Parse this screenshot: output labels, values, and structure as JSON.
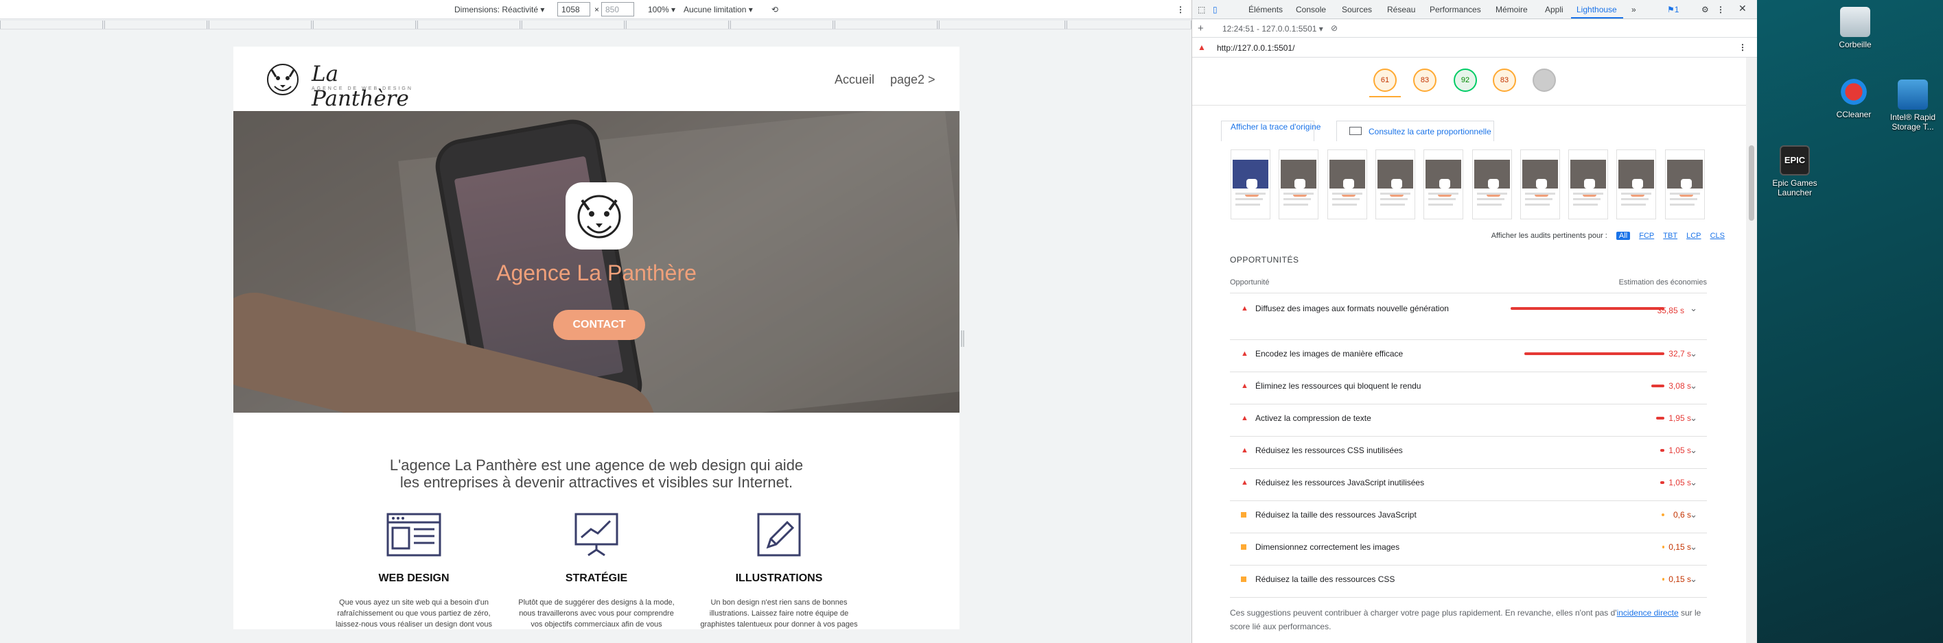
{
  "devtools_toolbar": {
    "dimensions_label": "Dimensions: Réactivité",
    "width": "1058",
    "height": "850",
    "zoom": "100%",
    "throttle": "Aucune limitation"
  },
  "site": {
    "logo_name": "La Panthère",
    "logo_tagline": "AGENCE DE WEB DESIGN",
    "nav": [
      "Accueil",
      "page2 >"
    ],
    "hero_title": "Agence La Panthère",
    "hero_cta": "CONTACT",
    "intro_line1": "L'agence La Panthère est une agence de web design qui aide",
    "intro_line2": "les entreprises à devenir attractives et visibles sur Internet.",
    "services": [
      {
        "title": "WEB DESIGN",
        "icon": "browser-layout-icon",
        "text": "Que vous ayez un site web qui a besoin d'un rafraîchissement ou que vous partiez de zéro, laissez-nous vous réaliser un design dont vous"
      },
      {
        "title": "STRATÉGIE",
        "icon": "presentation-chart-icon",
        "text": "Plutôt que de suggérer des designs à la mode, nous travaillerons avec vous pour comprendre vos objectifs commerciaux afin de vous"
      },
      {
        "title": "ILLUSTRATIONS",
        "icon": "pencil-icon",
        "text": "Un bon design n'est rien sans de bonnes illustrations. Laissez faire notre équipe de graphistes talentueux pour donner à vos pages"
      }
    ]
  },
  "devtools": {
    "tabs": [
      "Éléments",
      "Console",
      "Sources",
      "Réseau",
      "Performances",
      "Mémoire",
      "Appli",
      "Lighthouse"
    ],
    "active_tab": "Lighthouse",
    "issues_count": "1",
    "report_selector": "12:24:51 - 127.0.0.1:5501",
    "url": "http://127.0.0.1:5501/",
    "scores": [
      "61",
      "83",
      "92",
      "83",
      ""
    ],
    "trace_link": "Afficher la trace d'origine",
    "map_button": "Consultez la carte proportionnelle",
    "filter_label": "Afficher les audits pertinents pour :",
    "filter_chips": [
      "All",
      "FCP",
      "TBT",
      "LCP",
      "CLS"
    ],
    "opportunities_heading": "OPPORTUNITÉS",
    "col_opportunity": "Opportunité",
    "col_savings": "Estimation des économies",
    "opportunities": [
      {
        "label": "Diffusez des images aux formats nouvelle génération",
        "value": "35,85 s",
        "fraction": 1.0,
        "level": "red"
      },
      {
        "label": "Encodez les images de manière efficace",
        "value": "32,7 s",
        "fraction": 0.912,
        "level": "red"
      },
      {
        "label": "Éliminez les ressources qui bloquent le rendu",
        "value": "3,08 s",
        "fraction": 0.086,
        "level": "red"
      },
      {
        "label": "Activez la compression de texte",
        "value": "1,95 s",
        "fraction": 0.054,
        "level": "red"
      },
      {
        "label": "Réduisez les ressources CSS inutilisées",
        "value": "1,05 s",
        "fraction": 0.029,
        "level": "red"
      },
      {
        "label": "Réduisez les ressources JavaScript inutilisées",
        "value": "1,05 s",
        "fraction": 0.029,
        "level": "red"
      },
      {
        "label": "Réduisez la taille des ressources JavaScript",
        "value": "0,6 s",
        "fraction": 0.017,
        "level": "orange"
      },
      {
        "label": "Dimensionnez correctement les images",
        "value": "0,15 s",
        "fraction": 0.004,
        "level": "orange"
      },
      {
        "label": "Réduisez la taille des ressources CSS",
        "value": "0,15 s",
        "fraction": 0.004,
        "level": "orange"
      }
    ],
    "note_before": "Ces suggestions peuvent contribuer à charger votre page plus rapidement. En revanche, elles n'ont pas d'",
    "note_link": "incidence directe",
    "note_after": " sur le score lié aux performances."
  },
  "desktop": {
    "icons": [
      "Corbeille",
      "CCleaner",
      "Intel® Rapid Storage T...",
      "Epic Games Launcher"
    ]
  },
  "colors": {
    "accent": "#f0a07a",
    "devtools_blue": "#1a73e8",
    "fail_red": "#e53935",
    "average_orange": "#ffaa33",
    "pass_green": "#00cc66"
  }
}
